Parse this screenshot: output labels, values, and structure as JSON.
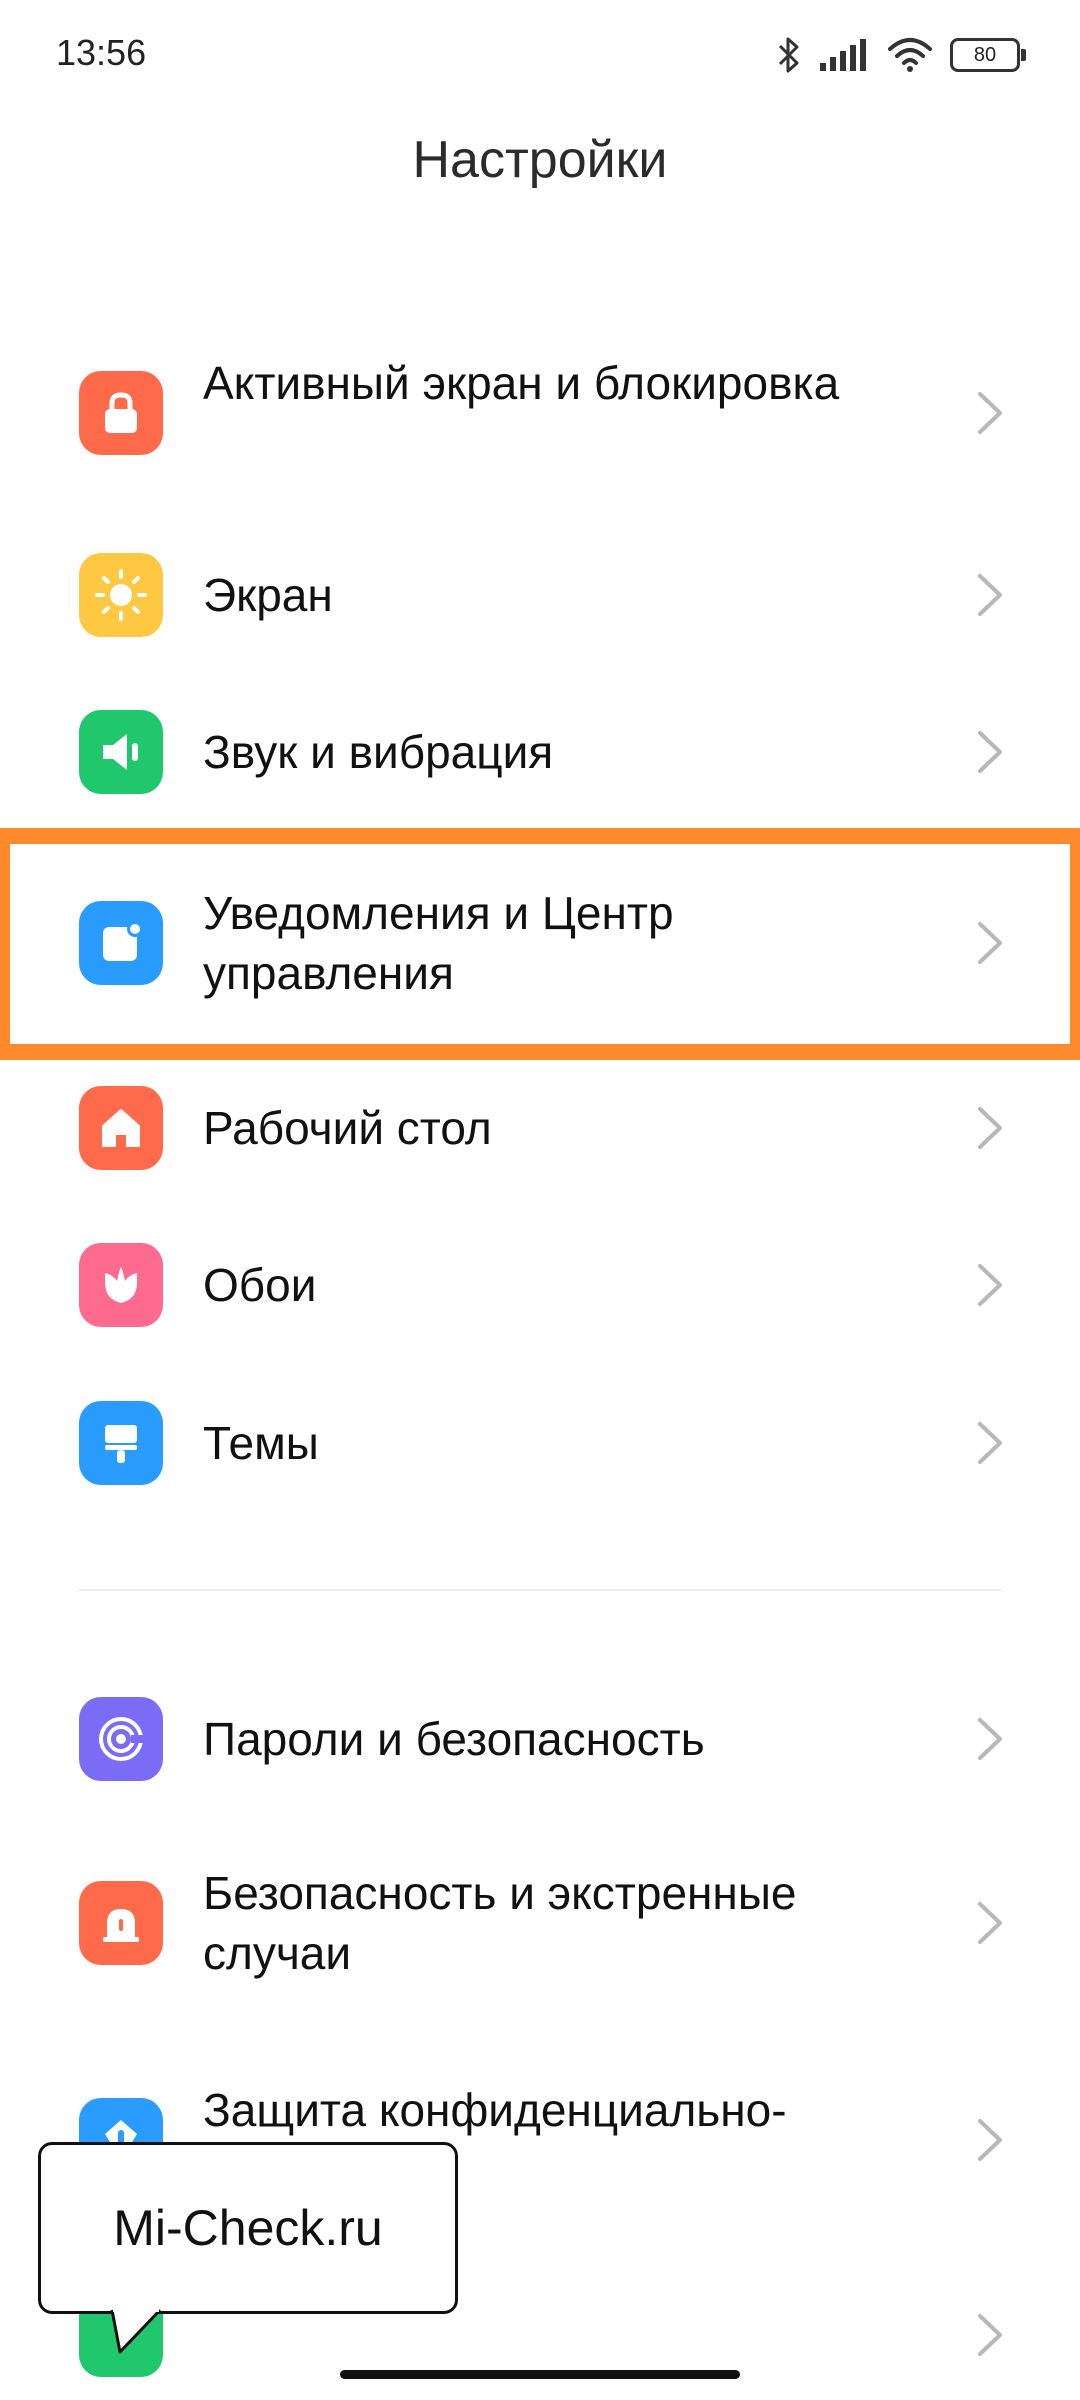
{
  "statusbar": {
    "time": "13:56",
    "battery": "80"
  },
  "title": "Настройки",
  "items": [
    {
      "label": "Активный экран и блокировка",
      "icon": "lock-icon",
      "color": "#ff6b4a"
    },
    {
      "label": "Экран",
      "icon": "brightness-icon",
      "color": "#ffc843"
    },
    {
      "label": "Звук и вибрация",
      "icon": "speaker-icon",
      "color": "#21c76d"
    },
    {
      "label": "Уведомления и Центр управления",
      "icon": "notification-icon",
      "color": "#2a9bff"
    },
    {
      "label": "Рабочий стол",
      "icon": "home-icon",
      "color": "#ff6b4a"
    },
    {
      "label": "Обои",
      "icon": "flower-icon",
      "color": "#ff6b8e"
    },
    {
      "label": "Темы",
      "icon": "paintbrush-icon",
      "color": "#2a9bff"
    },
    {
      "label": "Пароли и безопасность",
      "icon": "fingerprint-icon",
      "color": "#7b6cf6"
    },
    {
      "label": "Безопасность и экстренные случаи",
      "icon": "alarm-icon",
      "color": "#ff6b4a"
    },
    {
      "label": "Защита конфиденциально-",
      "icon": "privacy-shield-icon",
      "color": "#2a9bff"
    },
    {
      "label": "",
      "icon": "app-icon",
      "color": "#21c76d"
    }
  ],
  "highlight_color": "#ff8a2b",
  "watermark": "Mi-Check.ru"
}
